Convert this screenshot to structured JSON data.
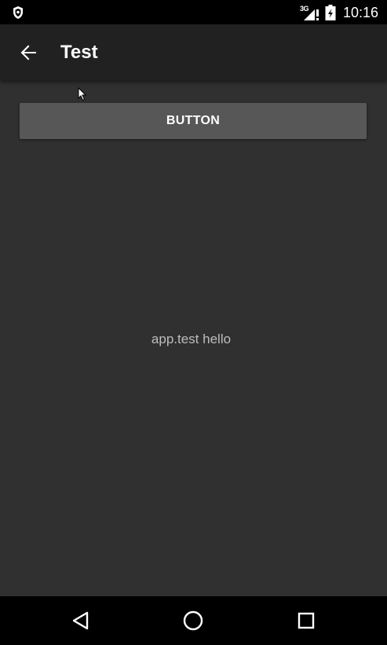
{
  "status_bar": {
    "network_type": "3G",
    "time": "10:16",
    "icons": [
      "shield-icon",
      "signal-icon",
      "battery-icon"
    ]
  },
  "app_bar": {
    "title": "Test",
    "back_icon": "arrow-back-icon"
  },
  "main": {
    "button_label": "BUTTON",
    "message": "app.test hello"
  },
  "nav_bar": {
    "buttons": [
      "back-triangle-icon",
      "home-circle-icon",
      "recents-square-icon"
    ]
  },
  "colors": {
    "background": "#303030",
    "app_bar": "#212121",
    "status_bar": "#000000",
    "button": "#575757",
    "text_primary": "#ffffff",
    "text_secondary": "#bdbdbd"
  }
}
